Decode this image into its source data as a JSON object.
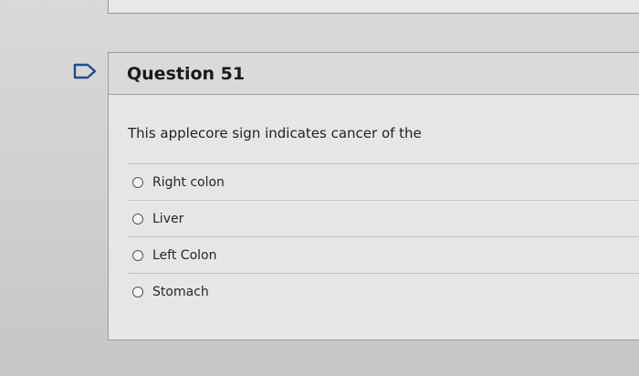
{
  "question": {
    "title": "Question 51",
    "text": "This applecore sign indicates cancer of the",
    "answers": [
      {
        "label": "Right colon"
      },
      {
        "label": "Liver"
      },
      {
        "label": "Left Colon"
      },
      {
        "label": "Stomach"
      }
    ]
  },
  "icons": {
    "flag": "flag-icon"
  },
  "colors": {
    "flag_stroke": "#1f4f8a"
  }
}
